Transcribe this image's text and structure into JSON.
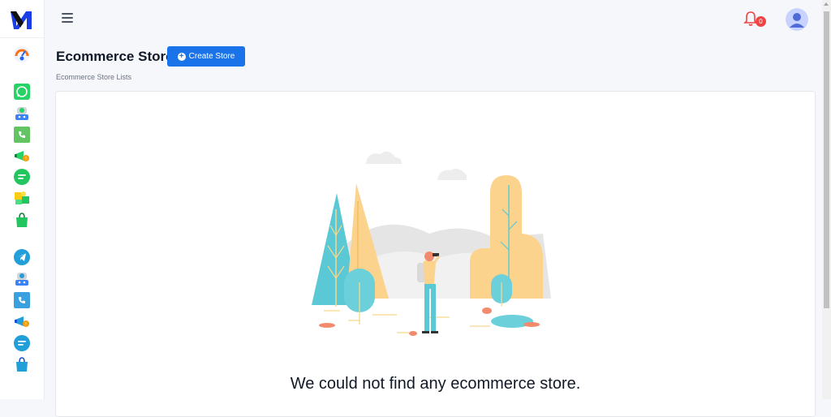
{
  "header": {
    "notification_count": "0"
  },
  "page": {
    "title": "Ecommerce Store",
    "create_button_label": "Create Store",
    "subtitle": "Ecommerce Store Lists"
  },
  "empty_state": {
    "message": "We could not find any ecommerce store."
  },
  "sidebar": {
    "icons": [
      "dashboard-icon",
      "whatsapp-icon",
      "whatsapp-bot-icon",
      "whatsapp-call-icon",
      "whatsapp-broadcast-icon",
      "whatsapp-chat-icon",
      "whatsapp-puzzle-icon",
      "whatsapp-shop-icon",
      "telegram-icon",
      "telegram-bot-icon",
      "telegram-call-icon",
      "telegram-broadcast-icon",
      "telegram-chat-icon",
      "telegram-shop-icon"
    ]
  },
  "colors": {
    "accent": "#1a73e8",
    "whatsapp": "#25d366",
    "telegram": "#229ed9",
    "badge": "#ef4444"
  }
}
